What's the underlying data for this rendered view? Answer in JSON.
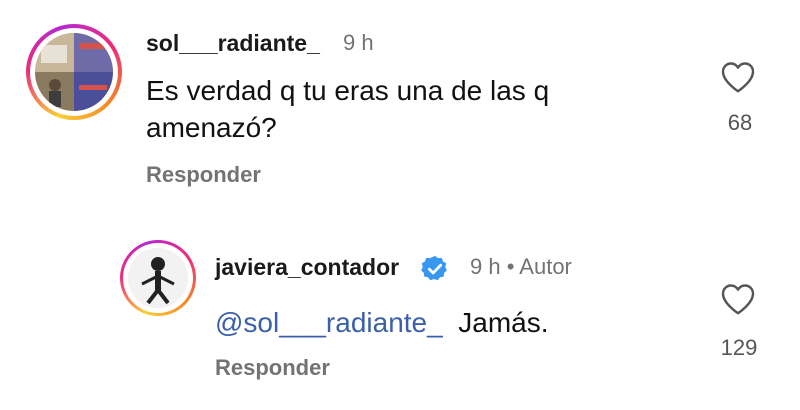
{
  "comments": [
    {
      "username": "sol___radiante_",
      "time": "9 h",
      "text": "Es verdad q tu eras una de las q amenazó?",
      "reply_label": "Responder",
      "like_count": "68"
    }
  ],
  "reply": {
    "username": "javiera_contador",
    "verified": true,
    "time": "9 h • Autor",
    "mention": "@sol___radiante_",
    "text": "Jamás.",
    "reply_label": "Responder",
    "like_count": "129"
  },
  "icons": {
    "like": "heart-outline-icon",
    "verified": "verified-badge-icon"
  },
  "colors": {
    "mention": "#3b5fa8",
    "verified": "#3897f0",
    "secondary_text": "#737373"
  }
}
